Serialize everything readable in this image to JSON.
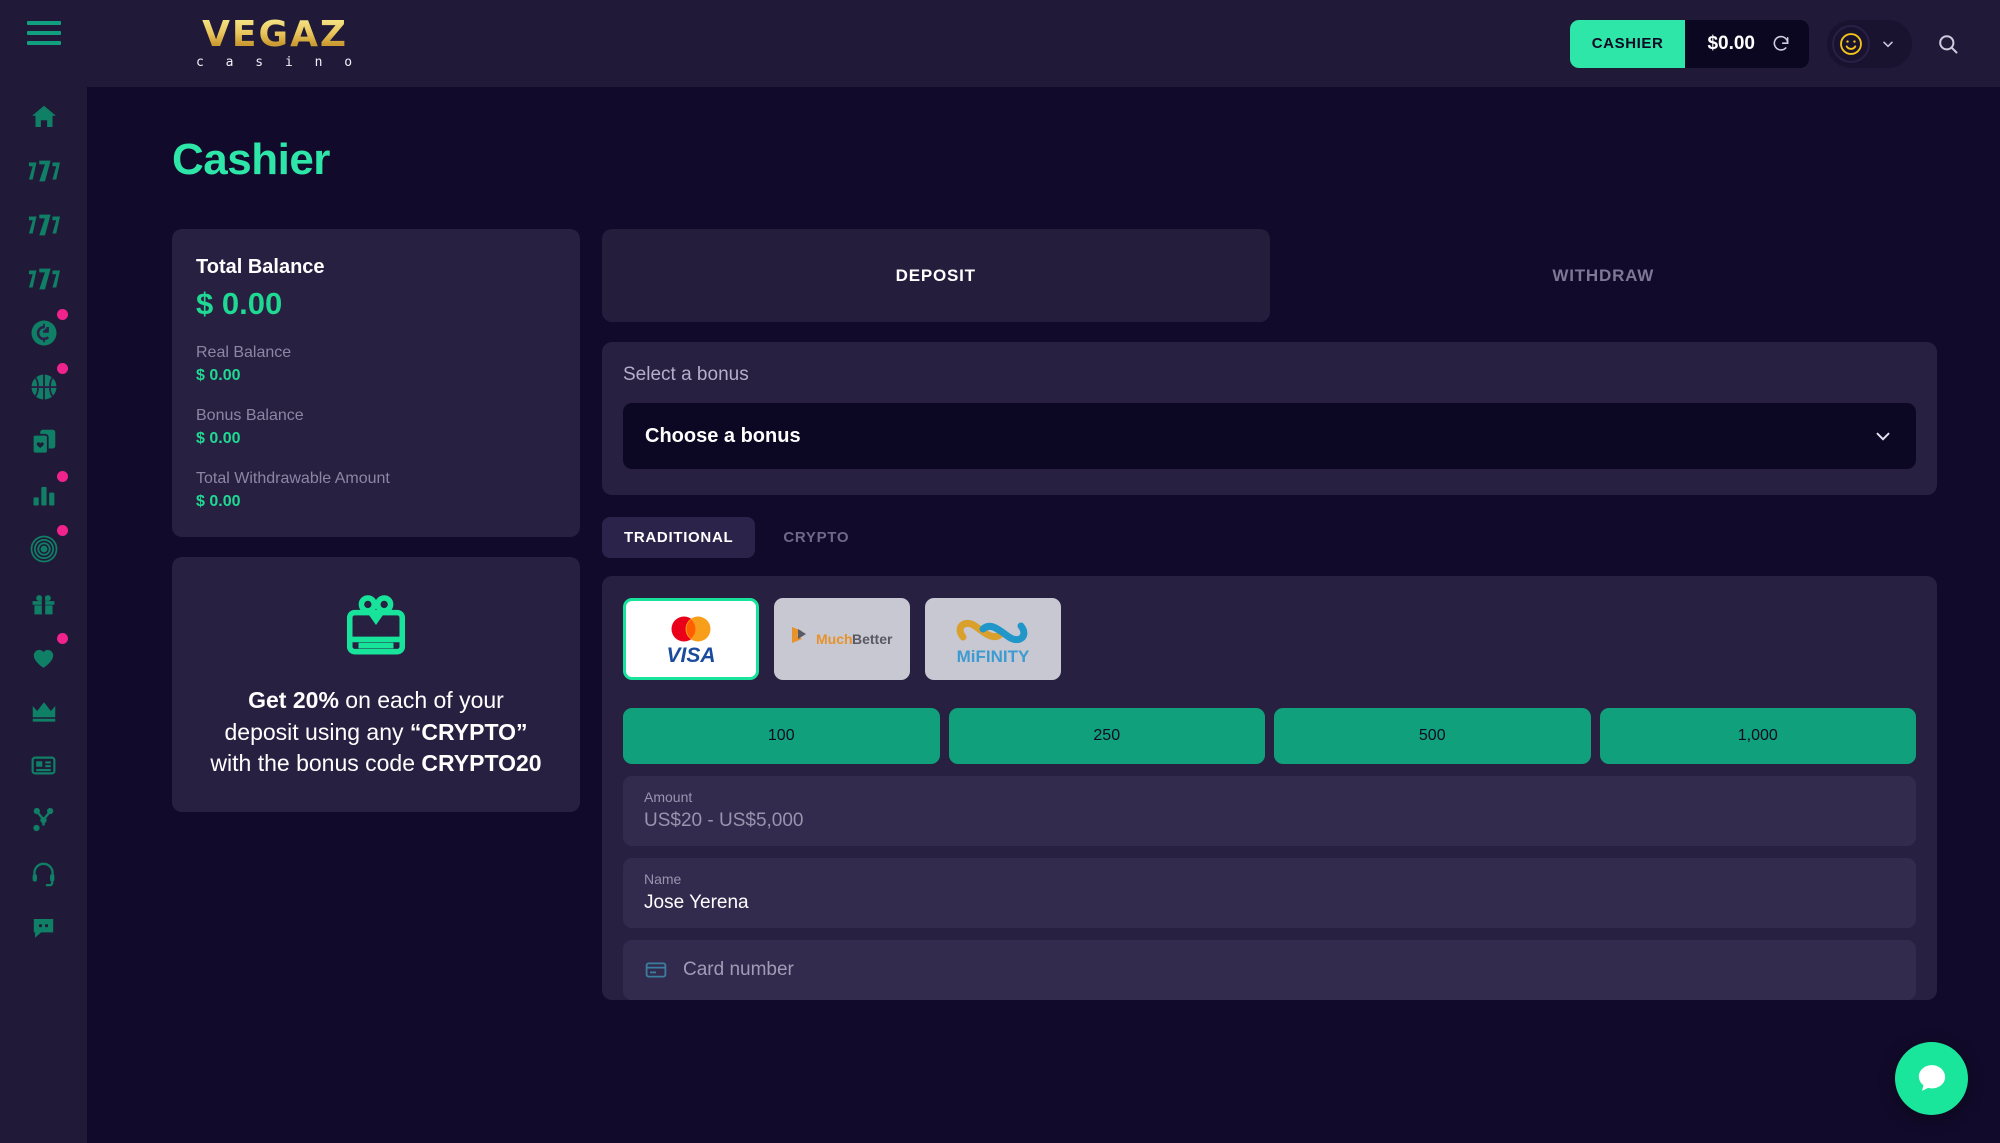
{
  "brand": {
    "name_top": "VEGAZ",
    "name_sub": "c a s i n o"
  },
  "header": {
    "cashier_label": "CASHIER",
    "balance": "$0.00",
    "refresh_icon": "refresh-icon",
    "avatar_icon": "smiley-avatar-icon",
    "chevron_icon": "chevron-down-icon",
    "search_icon": "search-icon"
  },
  "sidebar": {
    "menu_icon": "hamburger-menu-icon",
    "items": [
      {
        "icon": "home-icon",
        "badge": false
      },
      {
        "icon": "slots-777-icon",
        "badge": false
      },
      {
        "icon": "slots-777-icon",
        "badge": false
      },
      {
        "icon": "slots-777-icon",
        "badge": false
      },
      {
        "icon": "live-casino-icon",
        "badge": true
      },
      {
        "icon": "sports-basketball-icon",
        "badge": true
      },
      {
        "icon": "table-games-cards-icon",
        "badge": false
      },
      {
        "icon": "statistics-bars-icon",
        "badge": true
      },
      {
        "icon": "target-roulette-icon",
        "badge": true
      },
      {
        "icon": "gift-promotions-icon",
        "badge": false
      },
      {
        "icon": "heart-favorites-icon",
        "badge": true
      },
      {
        "icon": "crown-vip-icon",
        "badge": false
      },
      {
        "icon": "news-article-icon",
        "badge": false
      },
      {
        "icon": "affiliates-network-icon",
        "badge": false
      },
      {
        "icon": "headset-support-icon",
        "badge": false
      },
      {
        "icon": "chat-message-icon",
        "badge": false
      }
    ]
  },
  "page": {
    "title": "Cashier"
  },
  "balance_card": {
    "title": "Total Balance",
    "total": "$ 0.00",
    "rows": [
      {
        "label": "Real Balance",
        "value": "$ 0.00"
      },
      {
        "label": "Bonus Balance",
        "value": "$ 0.00"
      },
      {
        "label": "Total Withdrawable Amount",
        "value": "$ 0.00"
      }
    ]
  },
  "promo_card": {
    "icon": "gift-voucher-icon",
    "line1_bold": "Get 20%",
    "line1_rest": " on each of your",
    "line2_rest": "deposit using any ",
    "line2_bold": "“CRYPTO”",
    "line3_rest": "with the bonus code ",
    "line3_bold": "CRYPTO20"
  },
  "tabs": {
    "deposit": "DEPOSIT",
    "withdraw": "WITHDRAW",
    "active": "DEPOSIT"
  },
  "bonus": {
    "label": "Select a bonus",
    "selected": "Choose a bonus",
    "chevron_icon": "chevron-down-icon"
  },
  "method_tabs": {
    "traditional": "TRADITIONAL",
    "crypto": "CRYPTO",
    "active": "TRADITIONAL"
  },
  "payment_methods": [
    {
      "name": "visa-mastercard",
      "label": "VISA",
      "selected": true
    },
    {
      "name": "muchbetter",
      "label": "MuchBetter",
      "selected": false
    },
    {
      "name": "mifinity",
      "label": "MiFINITY",
      "selected": false
    }
  ],
  "quick_amounts": [
    "100",
    "250",
    "500",
    "1,000"
  ],
  "form": {
    "amount_label": "Amount",
    "amount_placeholder": "US$20 - US$5,000",
    "name_label": "Name",
    "name_value": "Jose Yerena",
    "card_icon": "credit-card-icon",
    "card_placeholder": "Card number"
  },
  "chat": {
    "icon": "chat-bubble-icon"
  },
  "colors": {
    "accent_green": "#2EE6A8",
    "button_green": "#11A07C",
    "badge_pink": "#F0238C",
    "sidebar_bg": "#201A38",
    "main_bg": "#120A2A",
    "card_bg": "#282041",
    "field_bg": "#332B4D"
  }
}
